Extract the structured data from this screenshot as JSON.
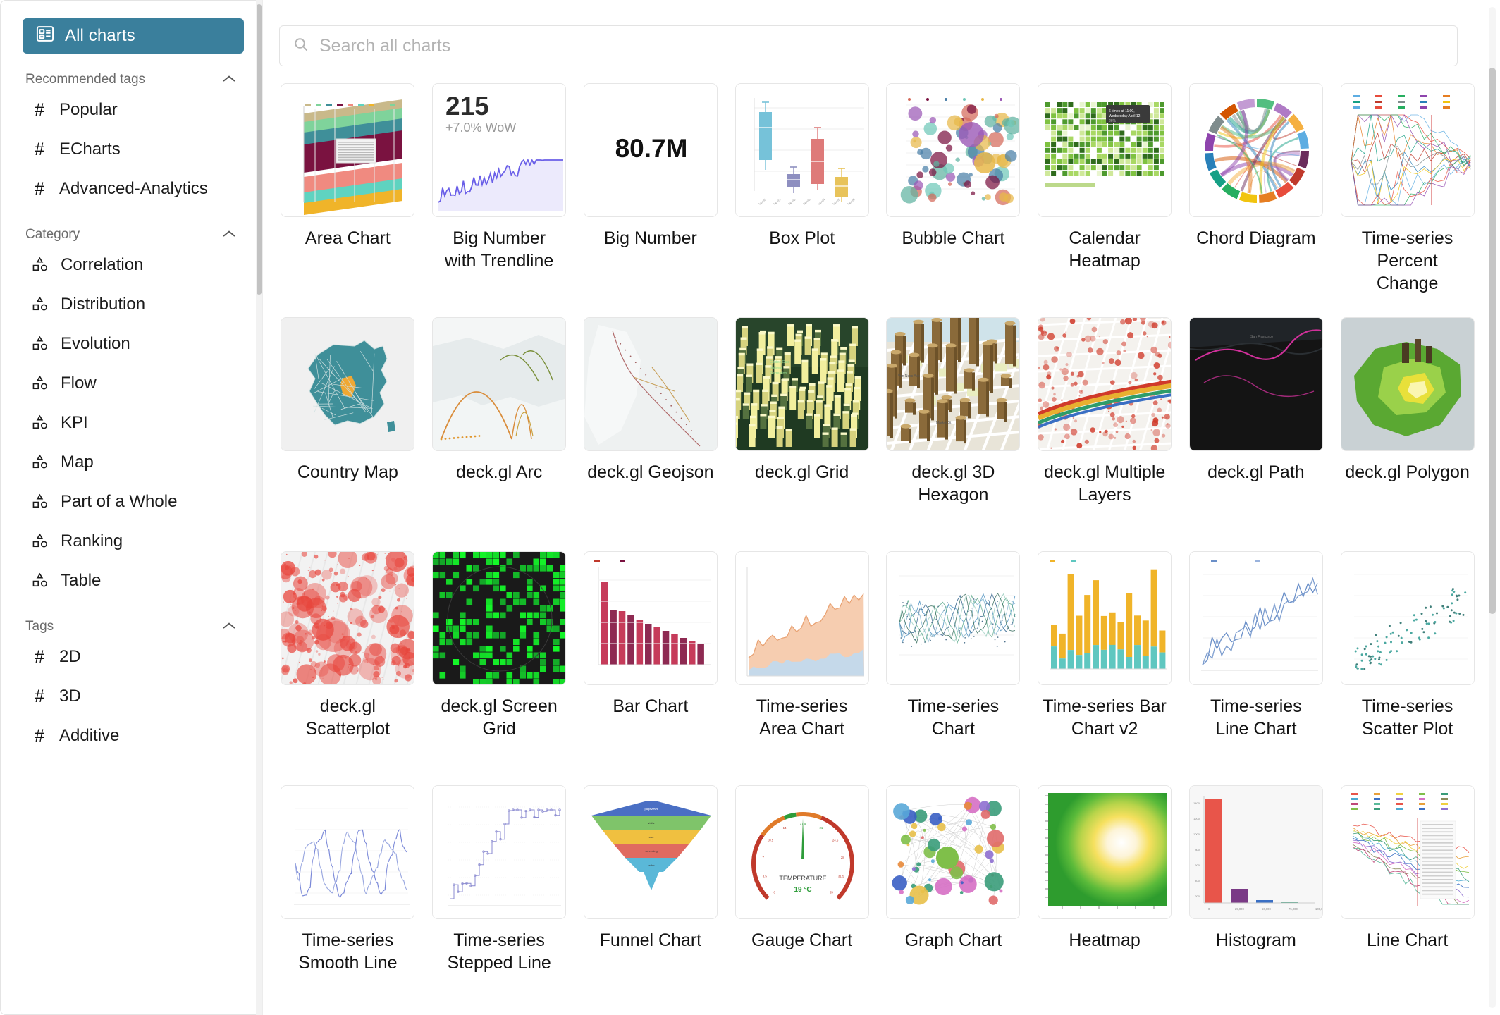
{
  "sidebar": {
    "all_charts": {
      "label": "All charts",
      "icon": "grid-list-icon",
      "active_color": "#3a7f9c"
    },
    "sections": [
      {
        "title": "Recommended tags",
        "collapse_icon": "chevron-up-icon",
        "icon_type": "hash",
        "items": [
          {
            "label": "Popular"
          },
          {
            "label": "ECharts"
          },
          {
            "label": "Advanced-Analytics"
          }
        ]
      },
      {
        "title": "Category",
        "collapse_icon": "chevron-up-icon",
        "icon_type": "shapes",
        "items": [
          {
            "label": "Correlation"
          },
          {
            "label": "Distribution"
          },
          {
            "label": "Evolution"
          },
          {
            "label": "Flow"
          },
          {
            "label": "KPI"
          },
          {
            "label": "Map"
          },
          {
            "label": "Part of a Whole"
          },
          {
            "label": "Ranking"
          },
          {
            "label": "Table"
          }
        ]
      },
      {
        "title": "Tags",
        "collapse_icon": "chevron-up-icon",
        "icon_type": "hash",
        "items": [
          {
            "label": "2D"
          },
          {
            "label": "3D"
          },
          {
            "label": "Additive"
          }
        ]
      }
    ]
  },
  "search": {
    "placeholder": "Search all charts",
    "value": "",
    "icon": "search-icon"
  },
  "gallery": {
    "charts": [
      {
        "name": "Area Chart",
        "thumb": "area-chart"
      },
      {
        "name": "Big Number with Trendline",
        "thumb": "big-number-trendline",
        "big_value": "215",
        "subheader": "+7.0% WoW"
      },
      {
        "name": "Big Number",
        "thumb": "big-number",
        "big_value": "80.7M"
      },
      {
        "name": "Box Plot",
        "thumb": "box-plot"
      },
      {
        "name": "Bubble Chart",
        "thumb": "bubble-chart"
      },
      {
        "name": "Calendar Heatmap",
        "thumb": "calendar-heatmap"
      },
      {
        "name": "Chord Diagram",
        "thumb": "chord-diagram"
      },
      {
        "name": "Time-series Percent Change",
        "thumb": "timeseries-percent-change"
      },
      {
        "name": "Country Map",
        "thumb": "country-map"
      },
      {
        "name": "deck.gl Arc",
        "thumb": "deckgl-arc"
      },
      {
        "name": "deck.gl Geojson",
        "thumb": "deckgl-geojson"
      },
      {
        "name": "deck.gl Grid",
        "thumb": "deckgl-grid"
      },
      {
        "name": "deck.gl 3D Hexagon",
        "thumb": "deckgl-3d-hexagon"
      },
      {
        "name": "deck.gl Multiple Layers",
        "thumb": "deckgl-multiple-layers"
      },
      {
        "name": "deck.gl Path",
        "thumb": "deckgl-path"
      },
      {
        "name": "deck.gl Polygon",
        "thumb": "deckgl-polygon"
      },
      {
        "name": "deck.gl Scatterplot",
        "thumb": "deckgl-scatterplot"
      },
      {
        "name": "deck.gl Screen Grid",
        "thumb": "deckgl-screen-grid"
      },
      {
        "name": "Bar Chart",
        "thumb": "bar-chart"
      },
      {
        "name": "Time-series Area Chart",
        "thumb": "timeseries-area-chart"
      },
      {
        "name": "Time-series Chart",
        "thumb": "timeseries-chart"
      },
      {
        "name": "Time-series Bar Chart v2",
        "thumb": "timeseries-bar-chart-v2"
      },
      {
        "name": "Time-series Line Chart",
        "thumb": "timeseries-line-chart"
      },
      {
        "name": "Time-series Scatter Plot",
        "thumb": "timeseries-scatter-plot"
      },
      {
        "name": "Time-series Smooth Line",
        "thumb": "timeseries-smooth-line"
      },
      {
        "name": "Time-series Stepped Line",
        "thumb": "timeseries-stepped-line"
      },
      {
        "name": "Funnel Chart",
        "thumb": "funnel-chart"
      },
      {
        "name": "Gauge Chart",
        "thumb": "gauge-chart",
        "gauge_label": "TEMPERATURE",
        "gauge_value": "19 °C"
      },
      {
        "name": "Graph Chart",
        "thumb": "graph-chart"
      },
      {
        "name": "Heatmap",
        "thumb": "heatmap"
      },
      {
        "name": "Histogram",
        "thumb": "histogram"
      },
      {
        "name": "Line Chart",
        "thumb": "line-chart"
      }
    ]
  },
  "colors": {
    "accent": "#3a7f9c",
    "text": "#141414",
    "muted": "#6b6b6b",
    "placeholder": "#b3b3b3",
    "border": "#e6e6e6"
  }
}
